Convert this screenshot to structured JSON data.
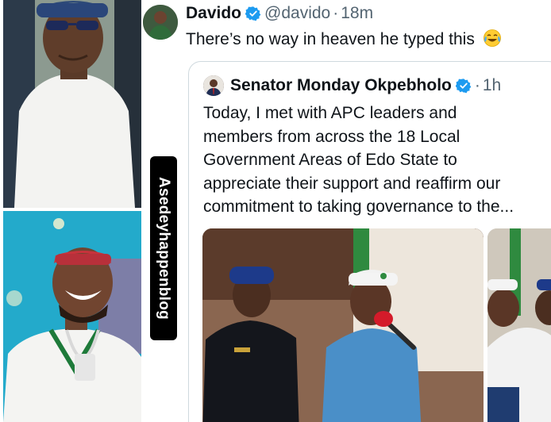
{
  "tweet": {
    "author_name": "Davido",
    "handle": "@davido",
    "separator": "·",
    "time": "18m",
    "text": "There’s no way in heaven he typed this",
    "verified": true
  },
  "quoted_tweet": {
    "author_name": "Senator Monday Okpebholo",
    "separator": "·",
    "time": "1h",
    "verified": true,
    "text_lines": [
      "Today, I met with APC leaders and",
      "members from across the 18 Local",
      "Government Areas of Edo State to",
      "appreciate their support and reaffirm our",
      "commitment to taking governance to the..."
    ]
  },
  "watermark": "Asedeyhappenblog",
  "colors": {
    "verified_blue": "#1d9bf0",
    "text_primary": "#0f1419",
    "text_secondary": "#536471",
    "card_border": "#cfd9de"
  },
  "icons": {
    "verified": "verified-badge-icon",
    "laughing_emoji": "face-with-tears-of-joy-icon"
  }
}
